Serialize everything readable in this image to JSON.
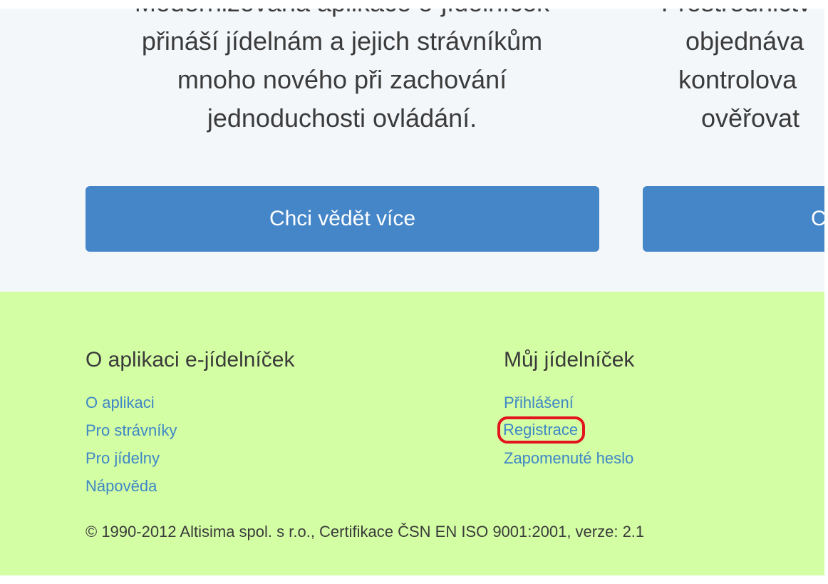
{
  "hero": {
    "left_text": [
      "Modernizovaná aplikace e-jídelníček",
      "přináší jídelnám a jejich strávníkům",
      "mnoho nového při zachování",
      "jednoduchosti ovládání."
    ],
    "right_text": [
      "Prostřednictv",
      "objednáva",
      "kontrolova",
      "ověřovat"
    ],
    "left_button": "Chci vědět více",
    "right_button": "C"
  },
  "footer": {
    "col1": {
      "heading": "O aplikaci e-jídelníček",
      "links": [
        "O aplikaci",
        "Pro strávníky",
        "Pro jídelny",
        "Nápověda"
      ]
    },
    "col2": {
      "heading": "Můj jídelníček",
      "links": [
        "Přihlášení",
        "Registrace",
        "Zapomenuté heslo"
      ]
    },
    "copyright": "© 1990-2012 Altisima spol. s r.o., Certifikace ČSN EN ISO 9001:2001, verze: 2.1"
  },
  "colors": {
    "hero_bg": "#f4f7fa",
    "button_bg": "#4586c8",
    "footer_bg": "#d3fea4",
    "link": "#3f86c6",
    "highlight": "#e3141d"
  }
}
